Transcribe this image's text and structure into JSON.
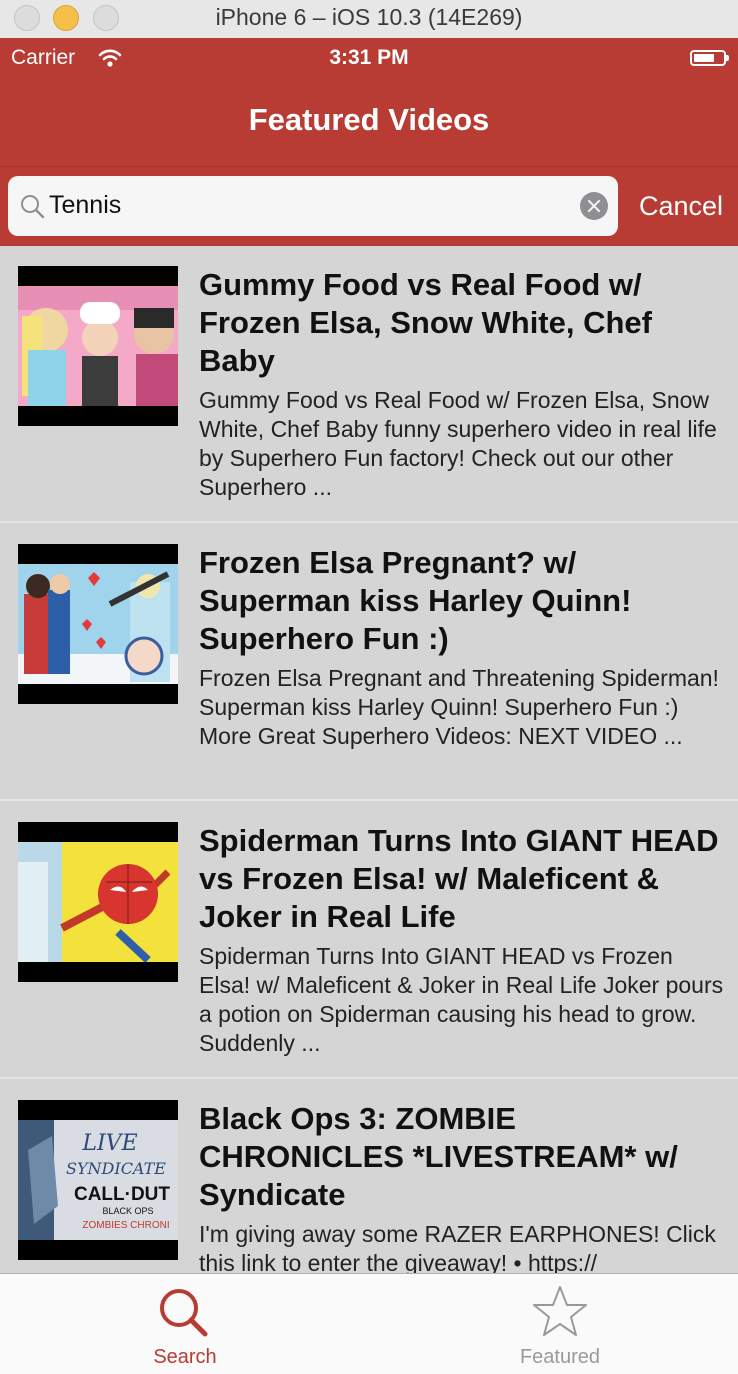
{
  "simulator": {
    "title": "iPhone 6 – iOS 10.3 (14E269)"
  },
  "status_bar": {
    "carrier": "Carrier",
    "time": "3:31 PM"
  },
  "nav": {
    "title": "Featured Videos"
  },
  "search": {
    "value": "Tennis",
    "cancel_label": "Cancel"
  },
  "colors": {
    "accent": "#b83c33",
    "list_bg": "#d5d5d5"
  },
  "videos": [
    {
      "title": "Gummy Food vs Real Food w/ Frozen Elsa, Snow White, Chef Baby",
      "description": "Gummy Food vs Real Food w/ Frozen Elsa, Snow White, Chef Baby funny superhero video in real life by Superhero Fun factory! Check out our other Superhero ..."
    },
    {
      "title": "Frozen Elsa Pregnant? w/ Superman kiss Harley Quinn! Superhero Fun :)",
      "description": "Frozen Elsa Pregnant and Threatening Spiderman! Superman kiss Harley Quinn! Superhero Fun :) More Great Superhero Videos: NEXT VIDEO ..."
    },
    {
      "title": "Spiderman Turns Into GIANT HEAD vs Frozen Elsa! w/ Maleficent & Joker in Real Life",
      "description": "Spiderman Turns Into GIANT HEAD vs Frozen Elsa! w/ Maleficent & Joker in Real Life Joker pours a potion on Spiderman causing his head to grow. Suddenly ..."
    },
    {
      "title": "Black Ops 3: ZOMBIE CHRONICLES *LIVESTREAM* w/ Syndicate",
      "description": "I'm giving away some RAZER EARPHONES! Click this link to enter the giveaway! • https://",
      "thumb_text": {
        "line1": "LIVE",
        "line2": "SYNDICATE",
        "line3": "CALL·DUT",
        "line4": "BLACK OPS",
        "line5": "ZOMBIES CHRONI"
      }
    }
  ],
  "tabs": [
    {
      "label": "Search",
      "icon": "search-icon",
      "selected": true
    },
    {
      "label": "Featured",
      "icon": "star-icon",
      "selected": false
    }
  ]
}
